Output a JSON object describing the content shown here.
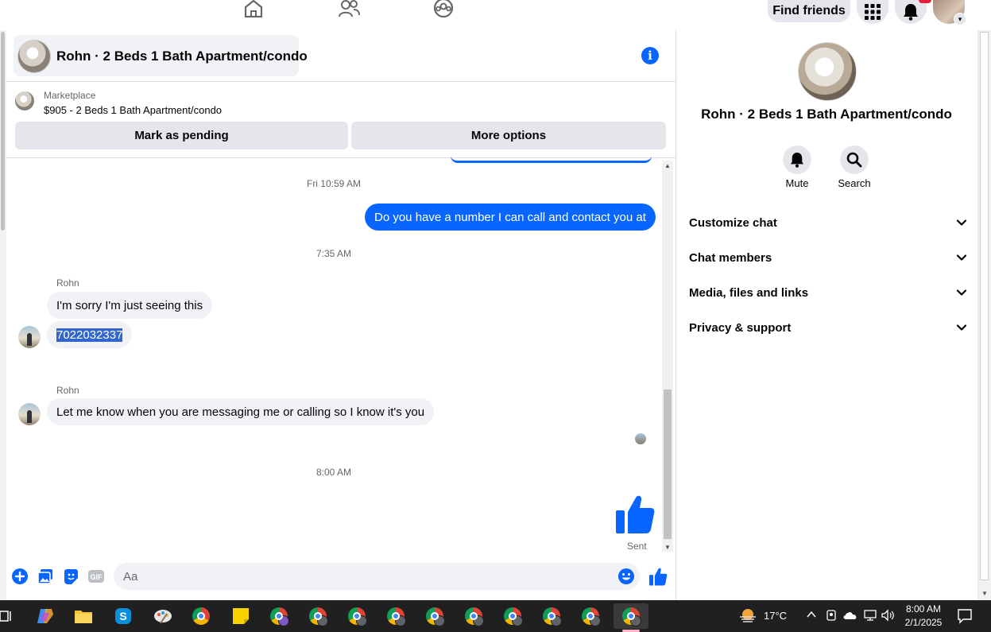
{
  "topbar": {
    "find_friends": "Find friends",
    "nav_icons": [
      "home-icon",
      "friends-icon",
      "groups-icon"
    ],
    "colors": {
      "notification_badge": "#e41e3f"
    }
  },
  "chat": {
    "title": "Rohn · 2 Beds 1 Bath Apartment/condo",
    "marketplace_label": "Marketplace",
    "listing": "$905 - 2 Beds 1 Bath Apartment/condo",
    "mark_pending": "Mark as pending",
    "more_options": "More options",
    "messages": {
      "ts1": "Fri 10:59 AM",
      "out1": "Do you have a number I can call and contact you at",
      "ts2": "7:35 AM",
      "sender1": "Rohn",
      "in1": "I'm sorry I'm just seeing this",
      "in2": "7022032337",
      "sender2": "Rohn",
      "in3": "Let me know when you are messaging me or calling so I know it's you",
      "ts3": "8:00 AM",
      "sent_status": "Sent"
    },
    "composer_placeholder": "Aa",
    "accent_color": "#0866ff"
  },
  "details": {
    "title": "Rohn · 2 Beds 1 Bath Apartment/condo",
    "mute": "Mute",
    "search": "Search",
    "sections": [
      "Customize chat",
      "Chat members",
      "Media, files and links",
      "Privacy & support"
    ]
  },
  "taskbar": {
    "weather": "17°C",
    "time": "8:00 AM",
    "date": "2/1/2025"
  }
}
